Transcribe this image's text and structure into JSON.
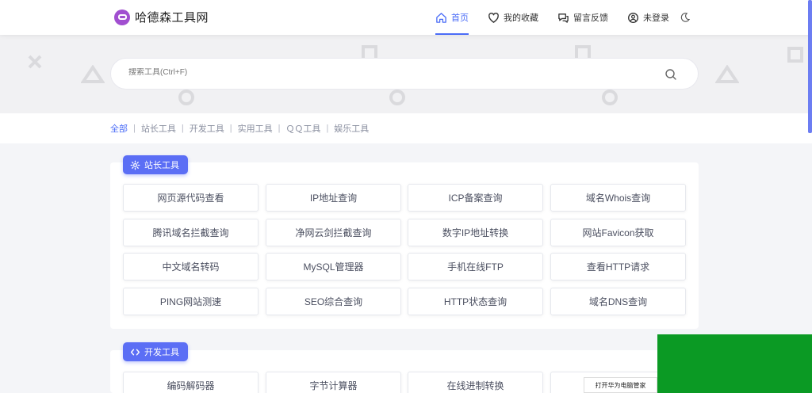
{
  "header": {
    "logo_text": "哈德森工具网",
    "nav": [
      {
        "label": "首页",
        "icon": "home-icon",
        "active": true
      },
      {
        "label": "我的收藏",
        "icon": "heart-icon",
        "active": false
      },
      {
        "label": "留言反馈",
        "icon": "chat-icon",
        "active": false
      },
      {
        "label": "未登录",
        "icon": "user-icon",
        "active": false
      }
    ],
    "theme_icon": "moon-icon"
  },
  "search": {
    "placeholder": "搜索工具(Ctrl+F)",
    "value": ""
  },
  "categories": [
    "全部",
    "站长工具",
    "开发工具",
    "实用工具",
    "ＱＱ工具",
    "娱乐工具"
  ],
  "active_category": "全部",
  "sections": [
    {
      "title": "站长工具",
      "icon": "gear-icon",
      "tools": [
        "网页源代码查看",
        "IP地址查询",
        "ICP备案查询",
        "域名Whois查询",
        "腾讯域名拦截查询",
        "净网云剑拦截查询",
        "数字IP地址转换",
        "网站Favicon获取",
        "中文域名转码",
        "MySQL管理器",
        "手机在线FTP",
        "查看HTTP请求",
        "PING网站测速",
        "SEO综合查询",
        "HTTP状态查询",
        "域名DNS查询"
      ]
    },
    {
      "title": "开发工具",
      "icon": "code-icon",
      "tools": [
        "编码解码器",
        "字节计算器",
        "在线进制转换"
      ]
    }
  ],
  "popup": {
    "text": "打开华为电脑管家"
  },
  "colors": {
    "accent": "#4a6cf7",
    "badge": "#5b6ef5",
    "overlay_green": "#0b9a24"
  }
}
